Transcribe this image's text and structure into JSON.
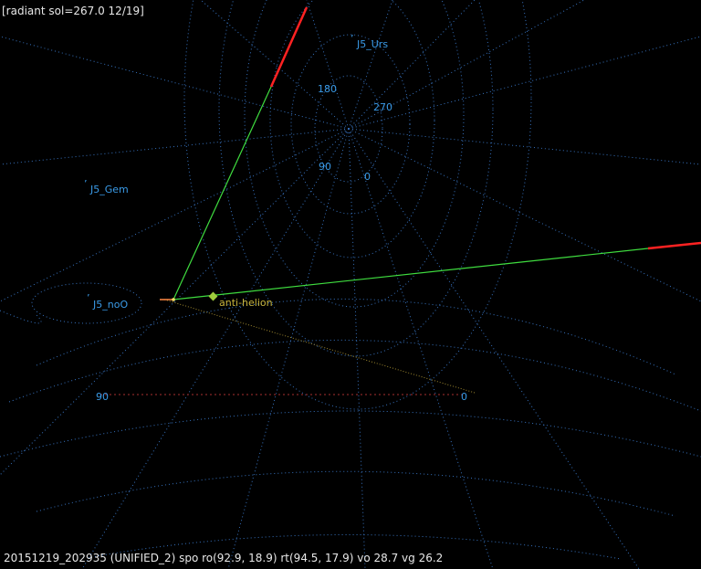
{
  "header": {
    "radiant_label": "[radiant sol=267.0 12/19]"
  },
  "status": {
    "line": "20151219_202935 (UNIFIED_2) spo ro(92.9, 18.9) rt(94.5, 17.9) vo 28.7 vg 26.2"
  },
  "radiants": [
    {
      "name": "J5_Urs"
    },
    {
      "name": "J5_Gem"
    },
    {
      "name": "J5_noO"
    }
  ],
  "polar_ring_labels": [
    "180",
    "270",
    "90",
    "0"
  ],
  "horizon_labels": [
    "90",
    "0"
  ],
  "anti_helion_label": "anti-helion",
  "colors": {
    "background": "#000000",
    "grid": "#3a78c8",
    "label": "#3a9be8",
    "track_green": "#3fdc3f",
    "track_red": "#ff2222",
    "anti_helion": "#c8b43c",
    "ecliptic": "#a08a30",
    "horizon_dash": "#a83030",
    "hud_text": "#e8e8e8"
  }
}
